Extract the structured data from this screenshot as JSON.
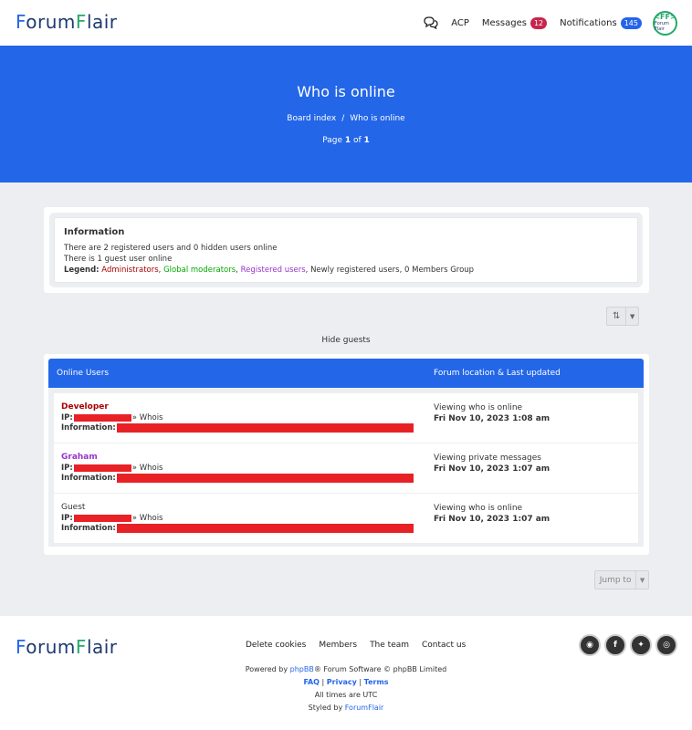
{
  "header": {
    "logo_a": "F",
    "logo_b": "orum",
    "logo_c": "F",
    "logo_d": "lair",
    "acp": "ACP",
    "messages_label": "Messages",
    "messages_count": "12",
    "notifications_label": "Notifications",
    "notifications_count": "145",
    "avatar_top": "<FF>",
    "avatar_bottom": "Forum Flair"
  },
  "hero": {
    "title": "Who is online",
    "breadcrumb": [
      "Board index",
      "/",
      "Who is online"
    ],
    "page_prefix": "Page ",
    "page_current": "1",
    "page_of": " of ",
    "page_total": "1"
  },
  "info": {
    "title": "Information",
    "line1": "There are 2 registered users and 0 hidden users online",
    "line2": "There is 1 guest user online",
    "legend_label": "Legend:",
    "legend_admin": "Administrators",
    "legend_gmod": "Global moderators",
    "legend_reg": "Registered users",
    "legend_rest": ", Newly registered users, 0 Members Group",
    "comma": ","
  },
  "controls": {
    "hide_guests": "Hide guests",
    "jump_to": "Jump to"
  },
  "table": {
    "col_users": "Online Users",
    "col_location": "Forum location & Last updated",
    "ip_label": "IP:",
    "whois": "» Whois",
    "info_label": "Information:",
    "rows": [
      {
        "name": "Developer",
        "location": "Viewing who is online",
        "time": "Fri Nov 10, 2023 1:08 am"
      },
      {
        "name": "Graham",
        "location": "Viewing private messages",
        "time": "Fri Nov 10, 2023 1:07 am"
      },
      {
        "name": "Guest",
        "location": "Viewing who is online",
        "time": "Fri Nov 10, 2023 1:07 am"
      }
    ]
  },
  "footer": {
    "links": [
      "Delete cookies",
      "Members",
      "The team",
      "Contact us"
    ],
    "powered_prefix": "Powered by ",
    "powered_link": "phpBB",
    "powered_suffix": "® Forum Software © phpBB Limited",
    "faq": "FAQ",
    "privacy": "Privacy",
    "terms": "Terms",
    "pipe": " | ",
    "timezone": "All times are UTC",
    "styled_prefix": "Styled by ",
    "styled_link": "ForumFlair"
  },
  "colors": {
    "brand_blue": "#2366e8",
    "admin": "#aa0000",
    "gmod": "#00aa00",
    "registered": "#9933cc",
    "redaction": "#e82126"
  }
}
